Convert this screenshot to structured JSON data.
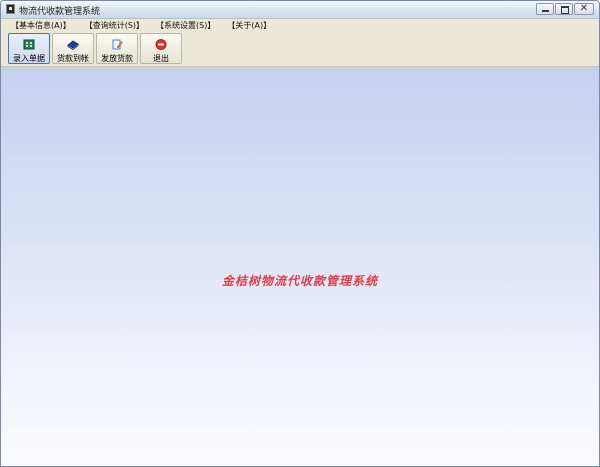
{
  "window": {
    "title": "物流代收款管理系统",
    "icon": "app-icon",
    "controls": {
      "minimize": "minimize-icon",
      "maximize": "maximize-icon",
      "close": "close-icon",
      "close_glyph": "✕"
    }
  },
  "menubar": {
    "items": [
      "【基本信息(A)】",
      "【查询统计(S)】",
      "【系统设置(S)】",
      "【关于(A)】"
    ]
  },
  "toolbar": {
    "buttons": [
      {
        "label": "录入单据",
        "icon": "ledger-icon",
        "icon_color": "#2e7d5a"
      },
      {
        "label": "货款到帐",
        "icon": "book-icon",
        "icon_color": "#1f3fae"
      },
      {
        "label": "发放货款",
        "icon": "document-edit-icon",
        "icon_color": "#5a7fbf"
      },
      {
        "label": "退出",
        "icon": "exit-icon",
        "icon_color": "#e03030"
      }
    ]
  },
  "main": {
    "banner_text": "金桔树物流代收款管理系统",
    "banner_color": "#e0404a"
  }
}
